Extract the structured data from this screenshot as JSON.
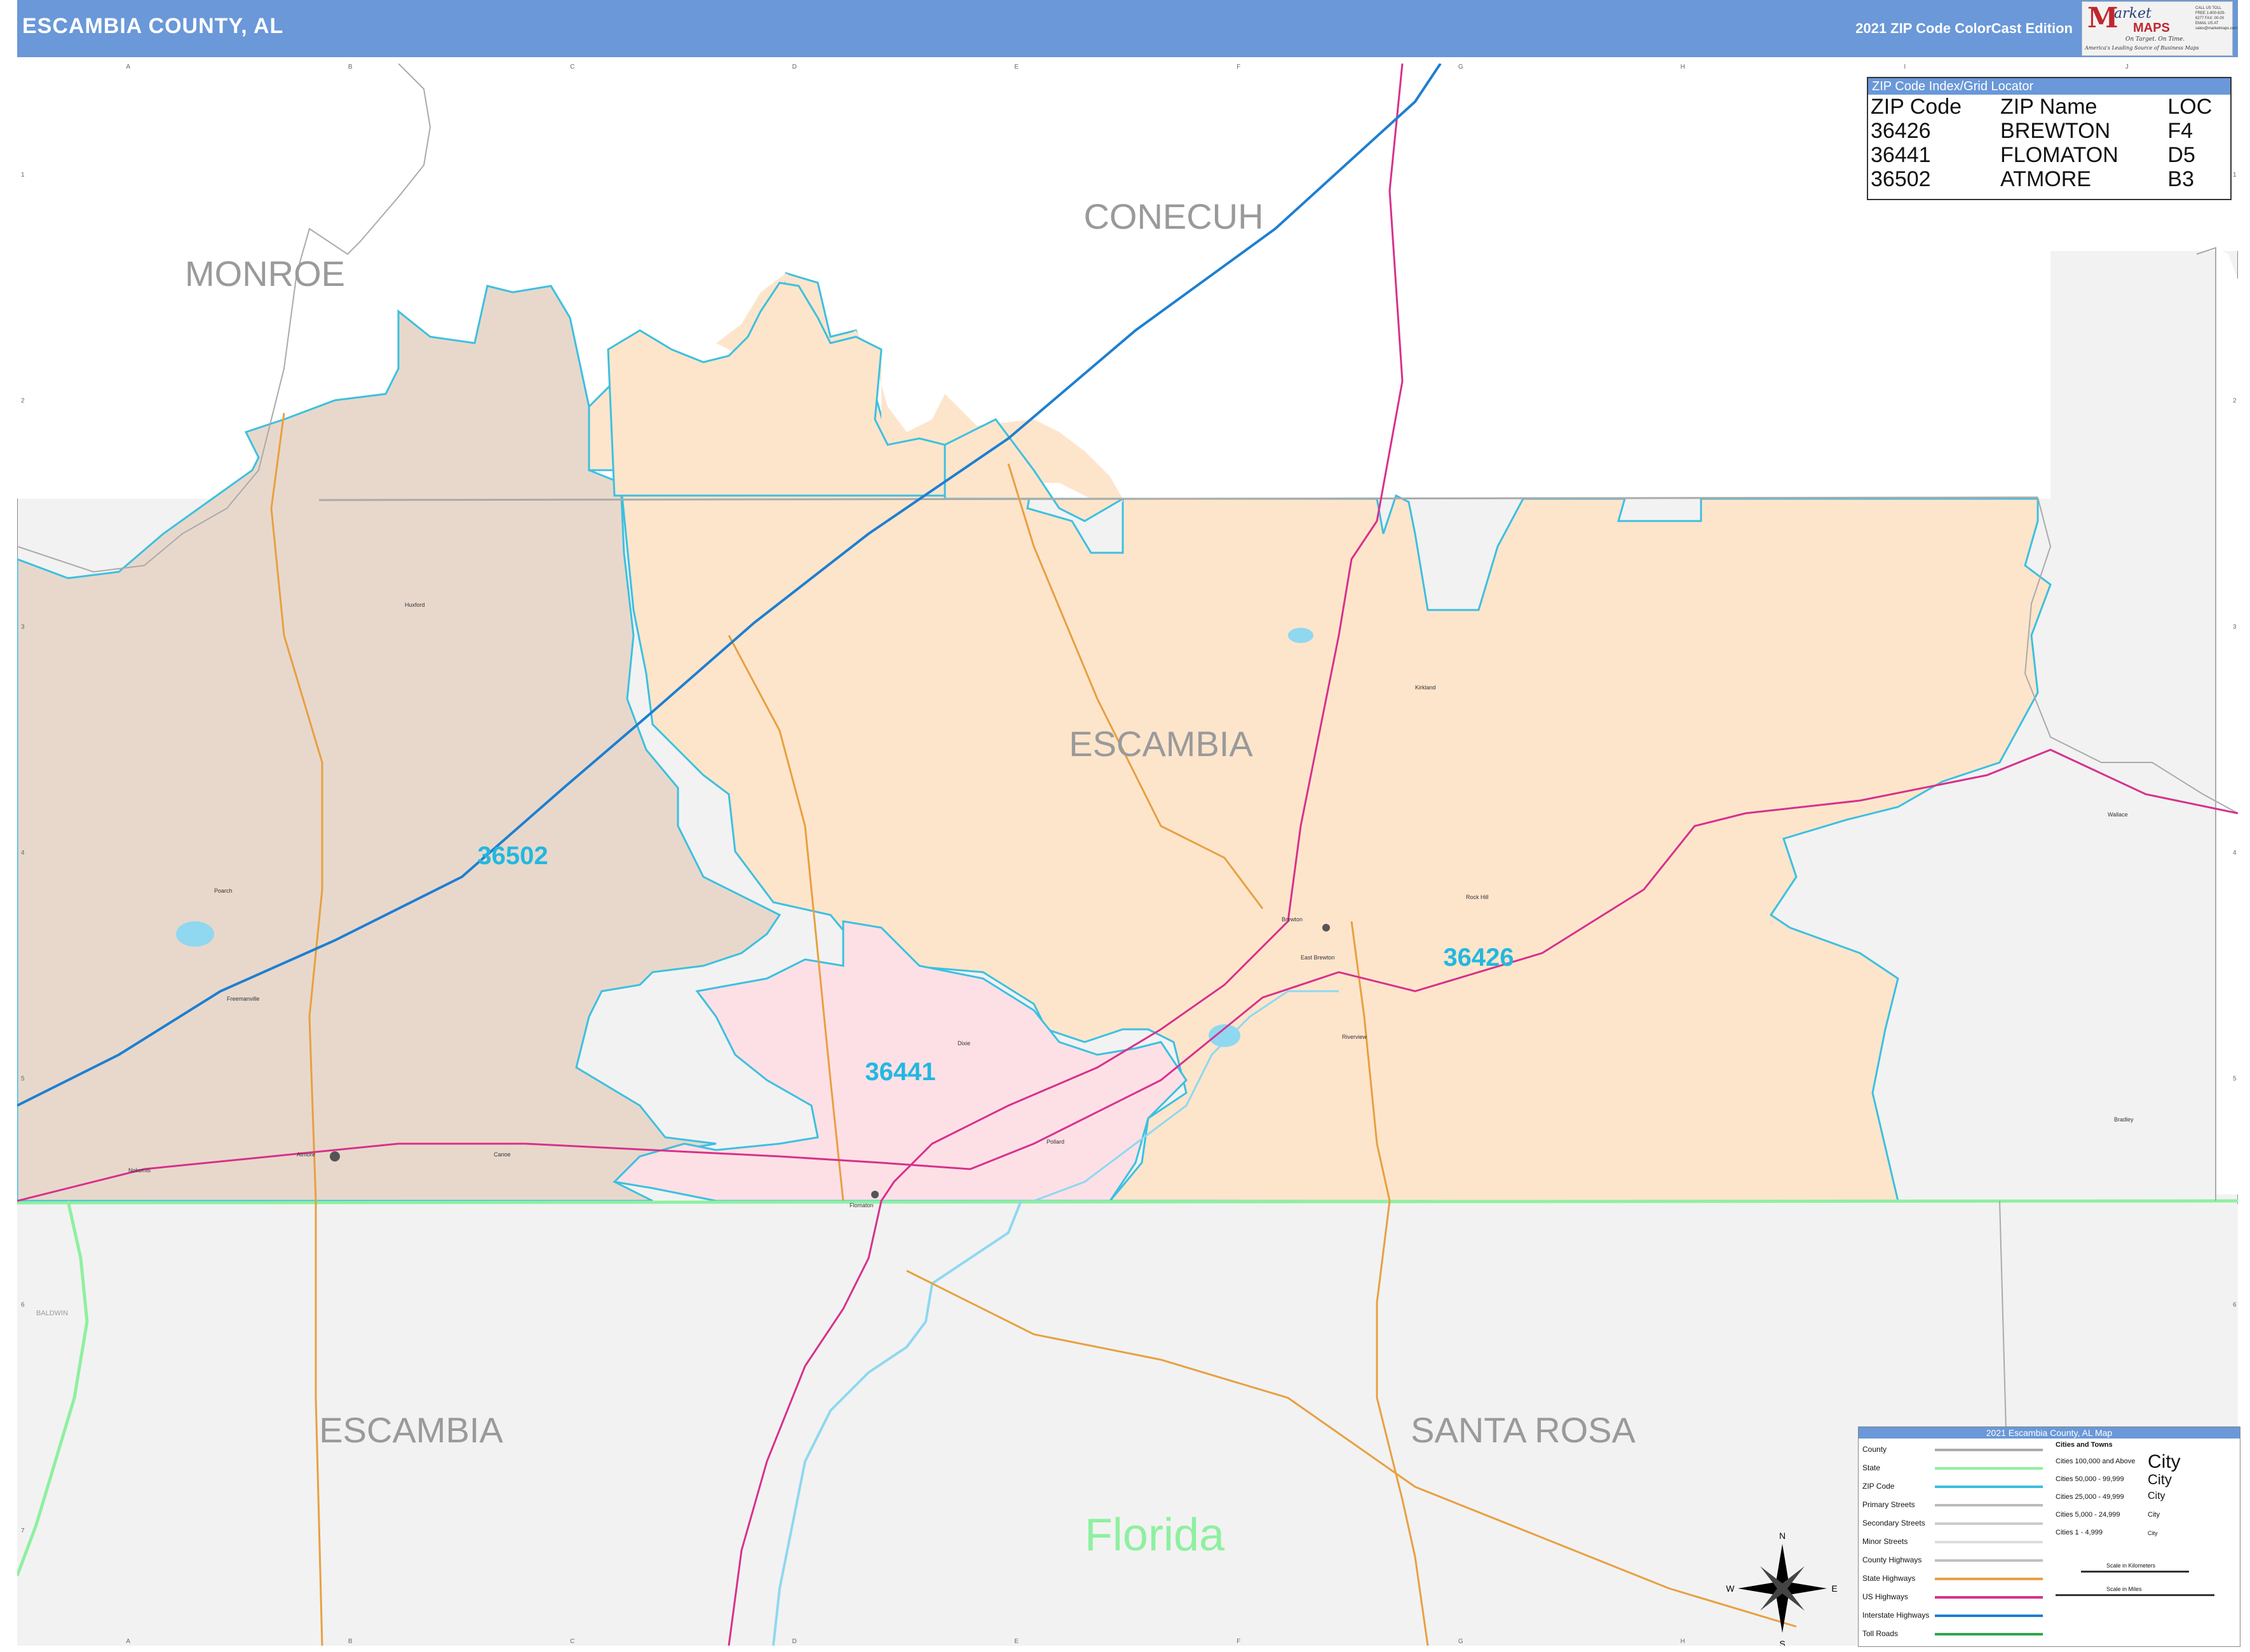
{
  "header": {
    "title": "ESCAMBIA COUNTY, AL",
    "edition": "2021 ZIP Code ColorCast Edition",
    "logo": {
      "brand_m": "M",
      "brand_rest": "arket",
      "brand_maps": "MAPS",
      "tagline": "On Target. On Time.",
      "subtagline": "America's Leading Source of Business Maps",
      "contact": "CALL US TOLL FREE 1-800-829-6277 FAX: 00-00 EMAIL US AT sales@marketmaps.com"
    }
  },
  "colors": {
    "header_bg": "#6a98d8",
    "zip_36426": "#fde5cc",
    "zip_36441": "#fde0e6",
    "zip_36502": "#e8d8cc",
    "zip_boundary": "#3cc0e0",
    "state_boundary": "#8ef0a0",
    "county_boundary": "#aaaaaa",
    "interstate": "#1e7fd0",
    "us_highway": "#d8308c",
    "state_highway": "#e8a040",
    "outside_county": "#f2f2f2",
    "water": "#8fd8f0"
  },
  "grid": {
    "columns": [
      "A",
      "B",
      "C",
      "D",
      "E",
      "F",
      "G",
      "H",
      "I",
      "J"
    ],
    "rows": [
      "1",
      "2",
      "3",
      "4",
      "5",
      "6",
      "7"
    ]
  },
  "map_labels": {
    "counties": [
      "MONROE",
      "CONECUH",
      "ESCAMBIA",
      "ESCAMBIA",
      "SANTA ROSA",
      "BALDWIN"
    ],
    "state": "Florida",
    "zip_codes": [
      "36502",
      "36426",
      "36441"
    ],
    "places": [
      "Huxford",
      "Kirkland",
      "Brewton",
      "East Brewton",
      "Rock Hill",
      "Riverview",
      "Poarch",
      "Freemanville",
      "Atmore",
      "Canoe",
      "Nokomis",
      "Flomaton",
      "Pollard",
      "Dixie",
      "Bradley",
      "Wallace"
    ]
  },
  "zip_index": {
    "title": "ZIP Code Index/Grid Locator",
    "columns": [
      "ZIP Code",
      "ZIP Name",
      "LOC"
    ],
    "rows": [
      [
        "36426",
        "BREWTON",
        "F4"
      ],
      [
        "36441",
        "FLOMATON",
        "D5"
      ],
      [
        "36502",
        "ATMORE",
        "B3"
      ]
    ]
  },
  "legend": {
    "title": "2021 Escambia County, AL Map",
    "line_items": [
      {
        "label": "County",
        "color": "#aaaaaa"
      },
      {
        "label": "State",
        "color": "#8ef0a0"
      },
      {
        "label": "ZIP Code",
        "color": "#3cc0e0"
      },
      {
        "label": "Primary Streets",
        "color": "#bbbbbb"
      },
      {
        "label": "Secondary Streets",
        "color": "#cccccc"
      },
      {
        "label": "Minor Streets",
        "color": "#dddddd"
      },
      {
        "label": "County Highways",
        "color": "#c0c0c0"
      },
      {
        "label": "State Highways",
        "color": "#e8a040"
      },
      {
        "label": "US Highways",
        "color": "#d8308c"
      },
      {
        "label": "Interstate Highways",
        "color": "#1e7fd0"
      },
      {
        "label": "Toll Roads",
        "color": "#2ea84a"
      }
    ],
    "cities_title": "Cities and Towns",
    "city_classes": [
      {
        "label": "Cities 100,000 and Above",
        "sample": "City"
      },
      {
        "label": "Cities 50,000 - 99,999",
        "sample": "City"
      },
      {
        "label": "Cities 25,000 - 49,999",
        "sample": "City"
      },
      {
        "label": "Cities 5,000 - 24,999",
        "sample": "City"
      },
      {
        "label": "Cities 1 - 4,999",
        "sample": "City"
      }
    ],
    "scale_km": "Scale in Kilometers",
    "scale_mi": "Scale in Miles"
  },
  "compass": {
    "n": "N",
    "s": "S",
    "e": "E",
    "w": "W"
  }
}
